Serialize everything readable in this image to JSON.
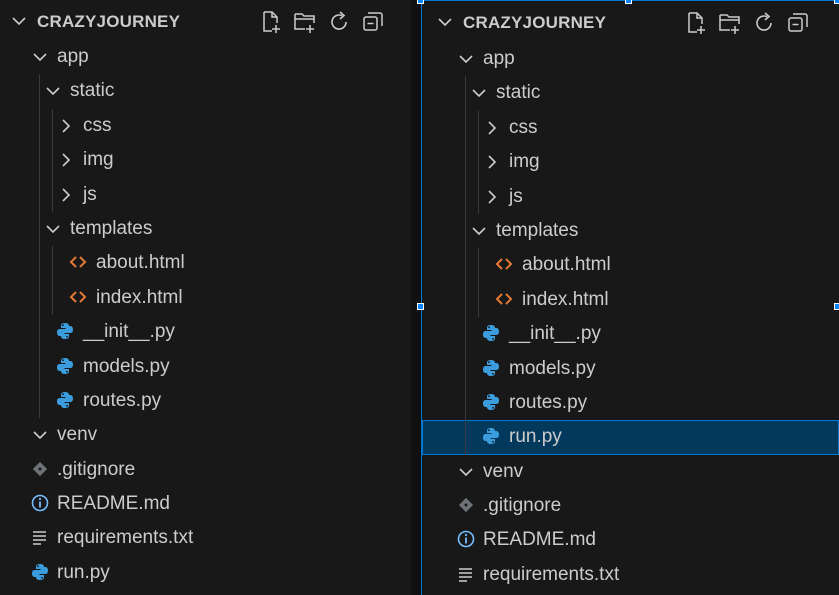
{
  "explorer": {
    "title": "CRAZYJOURNEY",
    "actions": [
      {
        "name": "new-file-icon"
      },
      {
        "name": "new-folder-icon"
      },
      {
        "name": "refresh-icon"
      },
      {
        "name": "collapse-all-icon"
      }
    ]
  },
  "left_tree": [
    {
      "label": "app",
      "kind": "folder",
      "depth": 1,
      "expanded": true
    },
    {
      "label": "static",
      "kind": "folder",
      "depth": 2,
      "expanded": true
    },
    {
      "label": "css",
      "kind": "folder",
      "depth": 3,
      "expanded": false
    },
    {
      "label": "img",
      "kind": "folder",
      "depth": 3,
      "expanded": false
    },
    {
      "label": "js",
      "kind": "folder",
      "depth": 3,
      "expanded": false
    },
    {
      "label": "templates",
      "kind": "folder",
      "depth": 2,
      "expanded": true
    },
    {
      "label": "about.html",
      "kind": "html",
      "depth": 3
    },
    {
      "label": "index.html",
      "kind": "html",
      "depth": 3
    },
    {
      "label": "__init__.py",
      "kind": "python",
      "depth": 2
    },
    {
      "label": "models.py",
      "kind": "python",
      "depth": 2
    },
    {
      "label": "routes.py",
      "kind": "python",
      "depth": 2
    },
    {
      "label": "venv",
      "kind": "folder",
      "depth": 1,
      "expanded": true
    },
    {
      "label": ".gitignore",
      "kind": "git",
      "depth": 1
    },
    {
      "label": "README.md",
      "kind": "info",
      "depth": 1
    },
    {
      "label": "requirements.txt",
      "kind": "text",
      "depth": 1
    },
    {
      "label": "run.py",
      "kind": "python",
      "depth": 1
    }
  ],
  "right_tree": [
    {
      "label": "app",
      "kind": "folder",
      "depth": 1,
      "expanded": true
    },
    {
      "label": "static",
      "kind": "folder",
      "depth": 2,
      "expanded": true
    },
    {
      "label": "css",
      "kind": "folder",
      "depth": 3,
      "expanded": false
    },
    {
      "label": "img",
      "kind": "folder",
      "depth": 3,
      "expanded": false
    },
    {
      "label": "js",
      "kind": "folder",
      "depth": 3,
      "expanded": false
    },
    {
      "label": "templates",
      "kind": "folder",
      "depth": 2,
      "expanded": true
    },
    {
      "label": "about.html",
      "kind": "html",
      "depth": 3
    },
    {
      "label": "index.html",
      "kind": "html",
      "depth": 3
    },
    {
      "label": "__init__.py",
      "kind": "python",
      "depth": 2
    },
    {
      "label": "models.py",
      "kind": "python",
      "depth": 2
    },
    {
      "label": "routes.py",
      "kind": "python",
      "depth": 2
    },
    {
      "label": "run.py",
      "kind": "python",
      "depth": 2,
      "selected": true
    },
    {
      "label": "venv",
      "kind": "folder",
      "depth": 1,
      "expanded": true
    },
    {
      "label": ".gitignore",
      "kind": "git",
      "depth": 1
    },
    {
      "label": "README.md",
      "kind": "info",
      "depth": 1
    },
    {
      "label": "requirements.txt",
      "kind": "text",
      "depth": 1
    }
  ],
  "colors": {
    "background": "#181818",
    "text": "#cccccc",
    "selection": "#04395e",
    "focus_border": "#0078d4",
    "html_icon": "#e37933",
    "python_icon": "#3b9ddd",
    "git_icon": "#6d7278",
    "info_icon": "#75beff"
  }
}
